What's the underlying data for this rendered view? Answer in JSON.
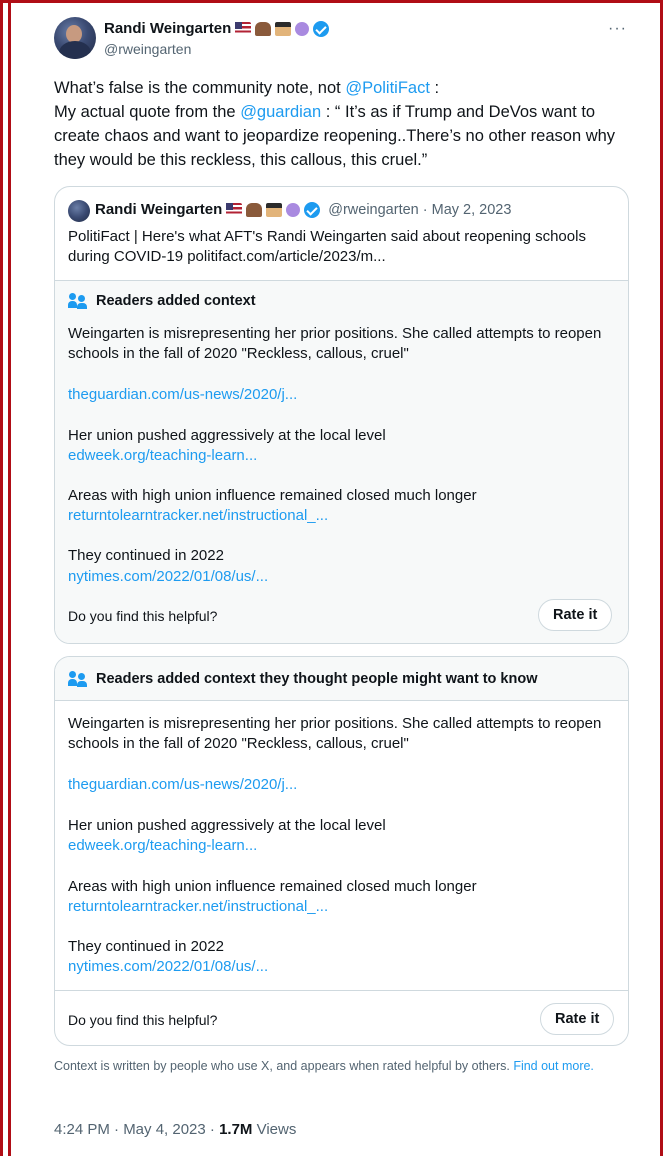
{
  "author": {
    "name": "Randi Weingarten",
    "handle": "@rweingarten"
  },
  "menu": {
    "more_label": "···"
  },
  "tweet": {
    "text_part1": "What’s false is the community note, not ",
    "mention1": "@PolitiFact",
    "text_part2": " :",
    "text_part3": "My actual quote from the ",
    "mention2": "@guardian",
    "text_part4": " : “ It’s as if Trump and DeVos want to create chaos and want to jeopardize reopening..There’s no other reason why they would be this reckless, this callous, this cruel.”"
  },
  "quoted": {
    "name": "Randi Weingarten",
    "handle_date": "@rweingarten · May 2, 2023",
    "text": "PolitiFact | Here's what AFT's Randi Weingarten said about reopening schools during COVID-19 politifact.com/article/2023/m..."
  },
  "note1": {
    "title": "Readers added context",
    "body1": "Weingarten is misrepresenting her prior positions. She called attempts to reopen schools in the fall of 2020 \"Reckless, callous, cruel\"",
    "link1": "theguardian.com/us-news/2020/j...",
    "body2": "Her union pushed aggressively at the local level",
    "link2": "edweek.org/teaching-learn...",
    "body3": "Areas with high union influence remained closed much longer",
    "link3": "returntolearntracker.net/instructional_...",
    "body4": "They continued in 2022",
    "link4": "nytimes.com/2022/01/08/us/...",
    "helpful_question": "Do you find this helpful?",
    "rate_label": "Rate it"
  },
  "note2": {
    "title": "Readers added context they thought people might want to know",
    "body1": "Weingarten is misrepresenting her prior positions. She called attempts to reopen schools in the fall of 2020 \"Reckless, callous, cruel\"",
    "link1": "theguardian.com/us-news/2020/j...",
    "body2": "Her union pushed aggressively at the local level",
    "link2": "edweek.org/teaching-learn...",
    "body3": "Areas with high union influence remained closed much longer",
    "link3": "returntolearntracker.net/instructional_...",
    "body4": "They continued in 2022",
    "link4": "nytimes.com/2022/01/08/us/...",
    "helpful_question": "Do you find this helpful?",
    "rate_label": "Rate it"
  },
  "footer": {
    "context_text": "Context is written by people who use X, and appears when rated helpful by others. ",
    "find_out_more": "Find out more.",
    "time": "4:24 PM · May 4, 2023 · ",
    "views_count": "1.7M",
    "views_label": " Views"
  },
  "colors": {
    "link": "#1d9bf0",
    "secondary_text": "#536471",
    "border": "#cfd9de",
    "frame_red": "#b00d16"
  },
  "icons": [
    "us-flag-emoji",
    "flexed-arm-emoji",
    "student-emoji",
    "purple-circle-emoji",
    "verified-badge-icon",
    "people-icon",
    "more-icon"
  ]
}
